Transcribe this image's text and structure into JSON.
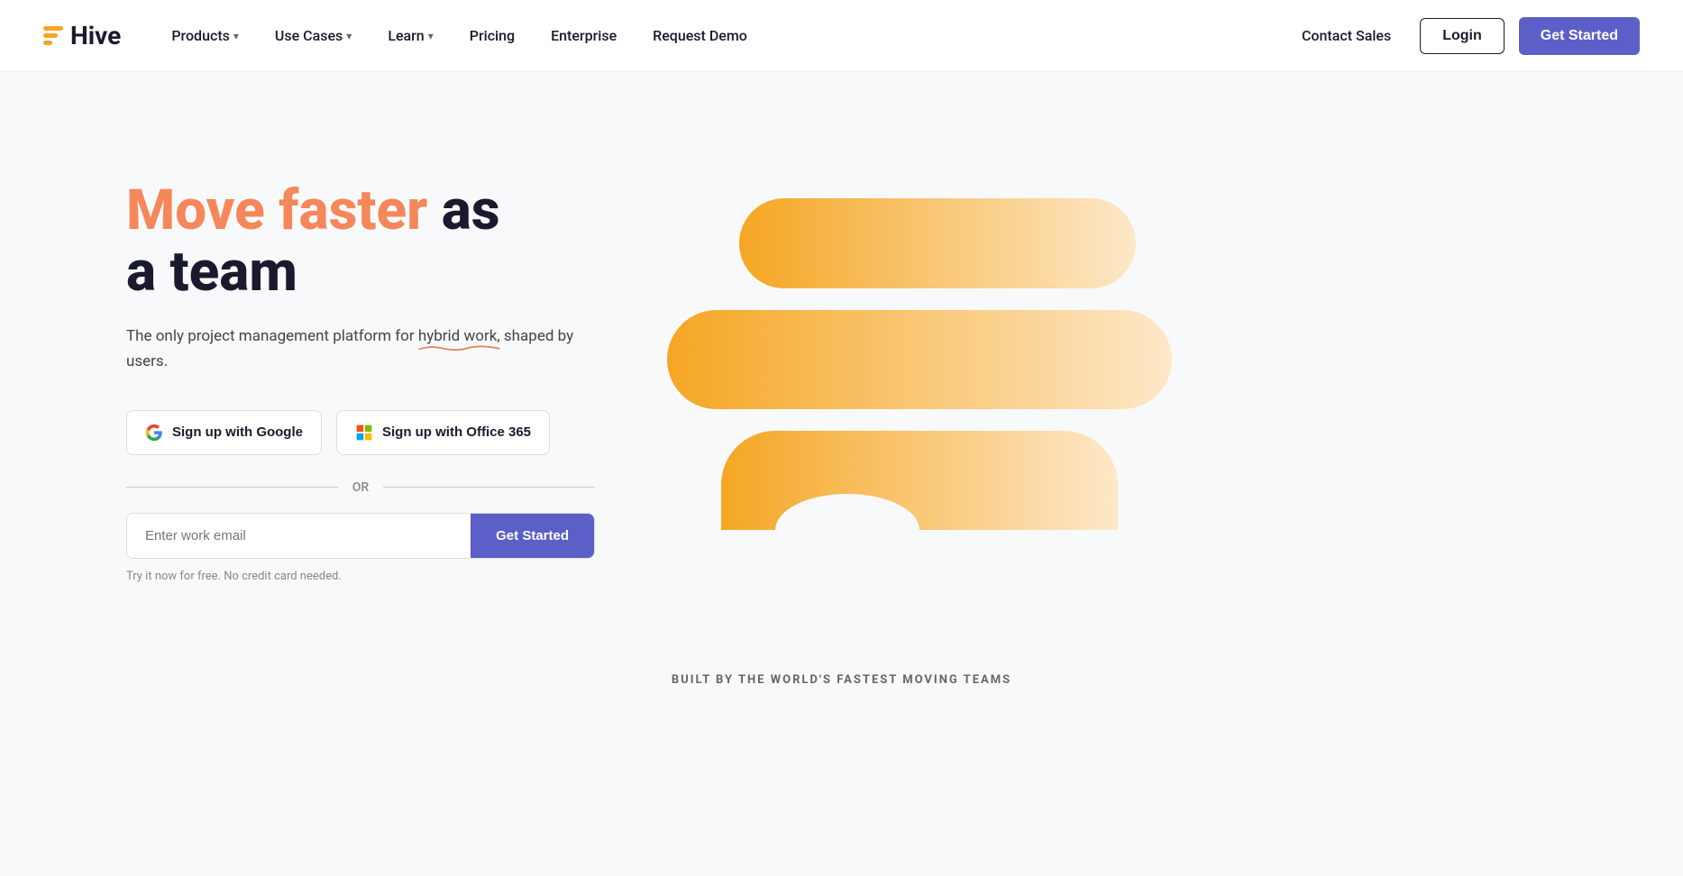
{
  "nav": {
    "logo_text": "Hive",
    "links": [
      {
        "label": "Products",
        "has_dropdown": true
      },
      {
        "label": "Use Cases",
        "has_dropdown": true
      },
      {
        "label": "Learn",
        "has_dropdown": true
      },
      {
        "label": "Pricing",
        "has_dropdown": false
      },
      {
        "label": "Enterprise",
        "has_dropdown": false
      },
      {
        "label": "Request Demo",
        "has_dropdown": false
      }
    ],
    "contact_sales": "Contact Sales",
    "login": "Login",
    "get_started": "Get Started"
  },
  "hero": {
    "title_orange": "Move faster",
    "title_dark_1": "as",
    "title_dark_2": "a team",
    "subtitle": "The only project management platform for hybrid work, shaped by users.",
    "signup_google": "Sign up with Google",
    "signup_office": "Sign up with Office 365",
    "or_text": "OR",
    "email_placeholder": "Enter work email",
    "get_started_btn": "Get Started",
    "free_trial": "Try it now for free. No credit card needed."
  },
  "footer": {
    "tagline": "BUILT BY THE WORLD'S FASTEST MOVING TEAMS"
  }
}
